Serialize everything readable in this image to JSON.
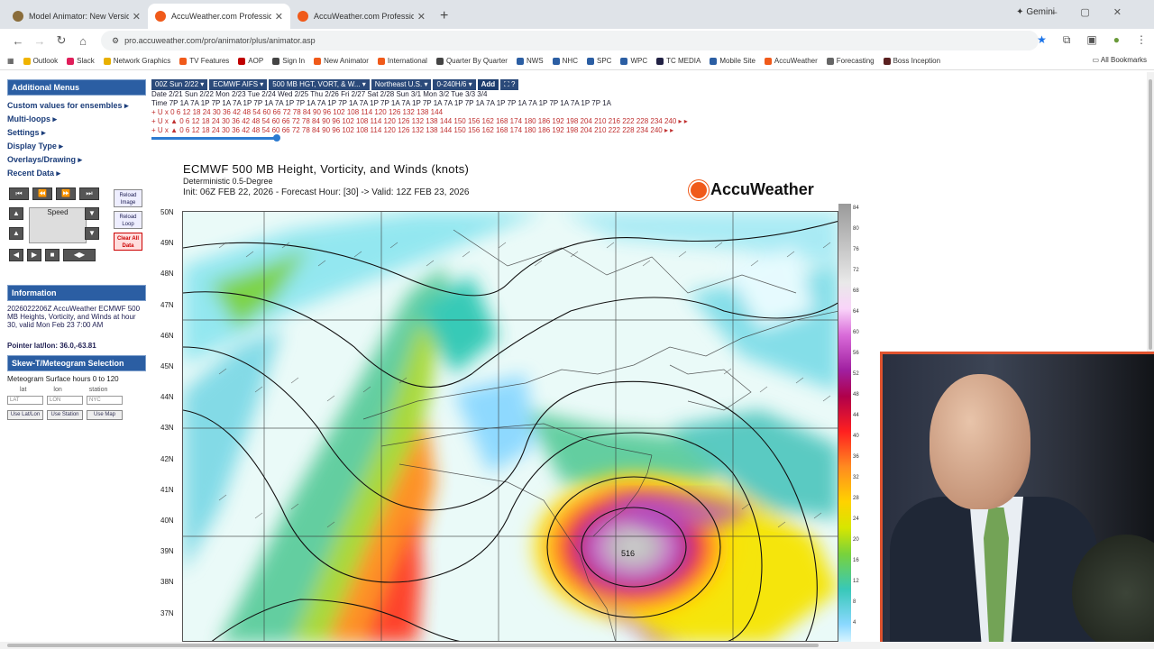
{
  "browser": {
    "tabs": [
      {
        "label": "Model Animator: New Version",
        "favicon_color": "#8a6d3b",
        "active": false
      },
      {
        "label": "AccuWeather.com Professional",
        "favicon_color": "#f05a1a",
        "active": true
      },
      {
        "label": "AccuWeather.com Professional",
        "favicon_color": "#f05a1a",
        "active": false
      }
    ],
    "new_tab": "+",
    "gemini_label": "Gemini",
    "url": "pro.accuweather.com/pro/animator/plus/animator.asp",
    "bookmarks": [
      {
        "label": "Outlook",
        "color": "#f0b400"
      },
      {
        "label": "Slack",
        "color": "#e01e5a"
      },
      {
        "label": "Network Graphics",
        "color": "#e8b000"
      },
      {
        "label": "TV Features",
        "color": "#f05a1a"
      },
      {
        "label": "AOP",
        "color": "#c00000"
      },
      {
        "label": "Sign In",
        "color": "#444444"
      },
      {
        "label": "New Animator",
        "color": "#f05a1a"
      },
      {
        "label": "International",
        "color": "#f05a1a"
      },
      {
        "label": "Quarter By Quarter",
        "color": "#444444"
      },
      {
        "label": "NWS",
        "color": "#2b5ea3"
      },
      {
        "label": "NHC",
        "color": "#2b5ea3"
      },
      {
        "label": "SPC",
        "color": "#2b5ea3"
      },
      {
        "label": "WPC",
        "color": "#2b5ea3"
      },
      {
        "label": "TC MEDIA",
        "color": "#222244"
      },
      {
        "label": "Mobile Site",
        "color": "#2b5ea3"
      },
      {
        "label": "AccuWeather",
        "color": "#f05a1a"
      },
      {
        "label": "Forecasting",
        "color": "#666666"
      },
      {
        "label": "Boss Inception",
        "color": "#5a2020"
      }
    ],
    "all_bookmarks": "All Bookmarks"
  },
  "sidebar": {
    "additional_menus": "Additional Menus",
    "menu_links": [
      "Custom values for ensembles ▸",
      "Multi-loops ▸",
      "Settings ▸",
      "Display Type ▸",
      "Overlays/Drawing ▸",
      "Recent Data ▸"
    ],
    "speed_label": "Speed",
    "reload_image": "Reload Image",
    "reload_loop": "Reload Loop",
    "clear_all": "Clear All Data",
    "information_title": "Information",
    "information_text": "2026022206Z AccuWeather ECMWF 500 MB Heights, Vorticity, and Winds at hour 30, valid Mon Feb 23 7:00 AM",
    "pointer": "Pointer lat/lon: 36.0,-63.81",
    "skewt_title": "Skew-T/Meteogram Selection",
    "meteogram_text": "Meteogram Surface hours 0 to 120",
    "meteo_cols": [
      "lat",
      "lon",
      "station"
    ],
    "meteo_placeholders": [
      "LAT",
      "LON",
      "NYC"
    ],
    "meteo_buttons": [
      "Use Lat/Lon",
      "Use Station",
      "Use Map"
    ]
  },
  "timebar": {
    "selectors": [
      "00Z Sun 2/22 ▾",
      "ECMWF AIFS ▾",
      "500 MB HGT, VORT, & W... ▾",
      "Northeast U.S. ▾",
      "0-240H/6 ▾",
      "Add",
      "⛶ ?"
    ],
    "row_date": "Date   2/21   Sun 2/22   Mon 2/23   Tue 2/24   Wed 2/25   Thu 2/26   Fri 2/27   Sat 2/28   Sun 3/1   Mon 3/2   Tue 3/3   3/4",
    "row_time": "Time   7P  1A 7A 1P 7P  1A 7A 1P 7P  1A 7A 1P 7P  1A 7A 1P 7P  1A 7A 1P 7P  1A 7A 1P 7P  1A 7A 1P 7P  1A 7A 1P 7P  1A 7A 1P 7P  1A 7A 1P 7P  1A",
    "row_a": "+ U x      0  6 12 18 24 30 36 42 48 54 60 66 72 78 84 90 96 102 108 114 120 126 132 138 144",
    "row_b": "+ U x ▲    0  6 12 18 24 30 36 42 48 54 60 66 72 78 84 90 96 102 108 114 120 126 132 138 144 150 156 162 168 174 180 186 192 198 204 210 216 222 228 234 240  ▸ ▸",
    "row_c": "+ U x ▲ 0  6 12 18 24 30 36 42 48 54 60 66 72 78 84 90 96 102 108 114 120 126 132 138 144 150 156 162 168 174 180 186 192 198 204 210 222 228 234 240  ▸ ▸"
  },
  "map": {
    "title": "ECMWF 500 MB Height, Vorticity, and Winds (knots)",
    "subtitle": "Deterministic 0.5-Degree",
    "init_line": "Init: 06Z FEB 22, 2026 - Forecast Hour: [30] -> Valid: 12Z FEB 23, 2026",
    "brand": "AccuWeather",
    "lat_labels": [
      "50N",
      "49N",
      "48N",
      "47N",
      "46N",
      "45N",
      "44N",
      "43N",
      "42N",
      "41N",
      "40N",
      "39N",
      "38N",
      "37N"
    ],
    "height_label": "516",
    "colorbar_ticks": [
      "84",
      "80",
      "76",
      "72",
      "68",
      "64",
      "60",
      "56",
      "52",
      "48",
      "44",
      "40",
      "36",
      "32",
      "28",
      "24",
      "20",
      "16",
      "12",
      "8",
      "4"
    ]
  }
}
